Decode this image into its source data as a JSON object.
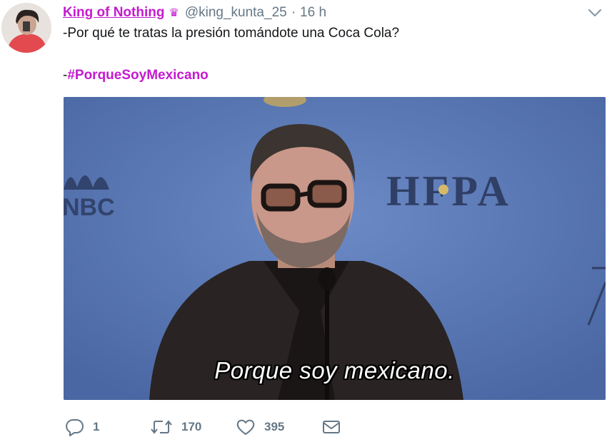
{
  "tweet": {
    "display_name": "King of Nothing",
    "crown_icon": "crown-icon",
    "handle": "@king_kunta_25",
    "separator": "·",
    "time": "16 h",
    "text_line1": "-Por qué te tratas la presión tomándote una Coca Cola?",
    "text_line2_prefix": "-",
    "hashtag": "#PorqueSoyMexicano",
    "media": {
      "caption": "Porque soy mexicano.",
      "logo_left": "NBC",
      "logo_right": "HFPA"
    },
    "actions": {
      "reply_count": "1",
      "retweet_count": "170",
      "like_count": "395"
    }
  },
  "colors": {
    "accent": "#c51acf",
    "muted": "#657786",
    "media_bg": "#5a79b5"
  }
}
